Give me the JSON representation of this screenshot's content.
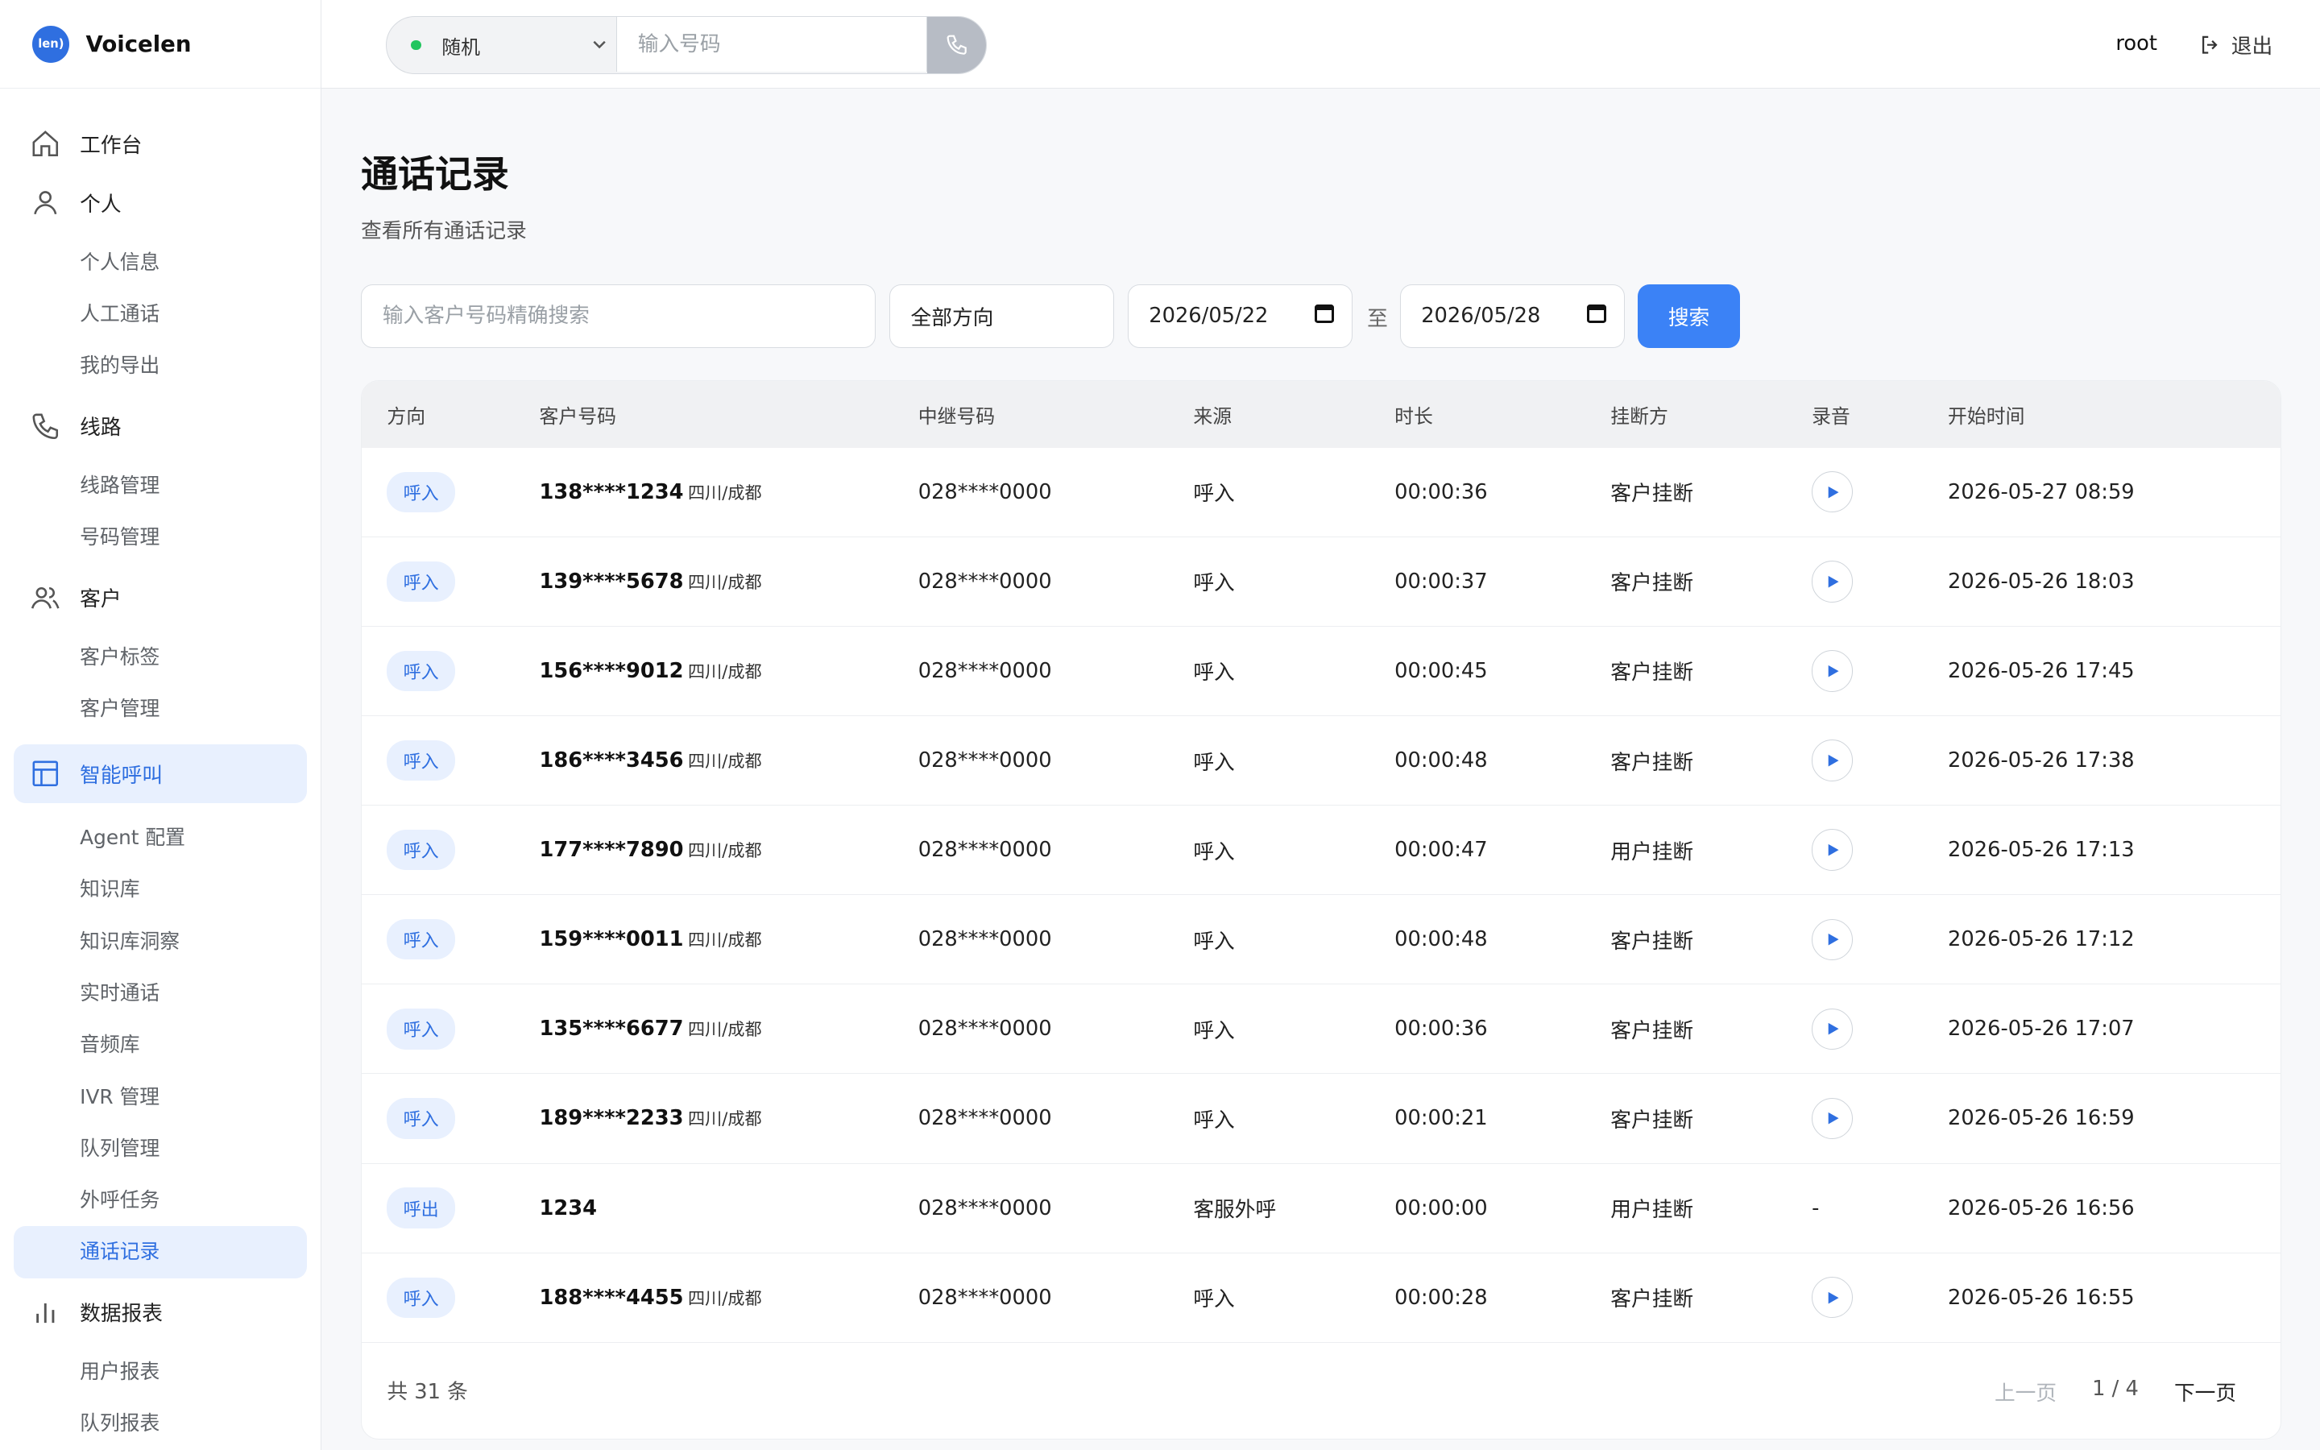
{
  "app": {
    "name": "Voicelen",
    "logo_text": "len)"
  },
  "sidebar": {
    "workbench": "工作台",
    "personal": "个人",
    "personal_items": [
      "个人信息",
      "人工通话",
      "我的导出"
    ],
    "lines": "线路",
    "lines_items": [
      "线路管理",
      "号码管理"
    ],
    "customer": "客户",
    "customer_items": [
      "客户标签",
      "客户管理"
    ],
    "smart_call": "智能呼叫",
    "smart_items": [
      "Agent 配置",
      "知识库",
      "知识库洞察",
      "实时通话",
      "音频库",
      "IVR 管理",
      "队列管理",
      "外呼任务",
      "通话记录"
    ],
    "reports": "数据报表",
    "reports_items": [
      "用户报表",
      "队列报表"
    ]
  },
  "topbar": {
    "mode": "随机",
    "phone_placeholder": "输入号码",
    "user": "root",
    "logout": "退出"
  },
  "page": {
    "title": "通话记录",
    "subtitle": "查看所有通话记录"
  },
  "filters": {
    "search_placeholder": "输入客户号码精确搜索",
    "direction": "全部方向",
    "date_from": "2026/05/22",
    "to": "至",
    "date_to": "2026/05/28",
    "search": "搜索"
  },
  "table": {
    "headers": [
      "方向",
      "客户号码",
      "中继号码",
      "来源",
      "时长",
      "挂断方",
      "录音",
      "开始时间"
    ],
    "rows": [
      {
        "dir": "呼入",
        "num": "138****1234",
        "loc": "四川/成都",
        "trunk": "028****0000",
        "src": "呼入",
        "dur": "00:00:36",
        "hang": "客户挂断",
        "rec": true,
        "time": "2026-05-27 08:59"
      },
      {
        "dir": "呼入",
        "num": "139****5678",
        "loc": "四川/成都",
        "trunk": "028****0000",
        "src": "呼入",
        "dur": "00:00:37",
        "hang": "客户挂断",
        "rec": true,
        "time": "2026-05-26 18:03"
      },
      {
        "dir": "呼入",
        "num": "156****9012",
        "loc": "四川/成都",
        "trunk": "028****0000",
        "src": "呼入",
        "dur": "00:00:45",
        "hang": "客户挂断",
        "rec": true,
        "time": "2026-05-26 17:45"
      },
      {
        "dir": "呼入",
        "num": "186****3456",
        "loc": "四川/成都",
        "trunk": "028****0000",
        "src": "呼入",
        "dur": "00:00:48",
        "hang": "客户挂断",
        "rec": true,
        "time": "2026-05-26 17:38"
      },
      {
        "dir": "呼入",
        "num": "177****7890",
        "loc": "四川/成都",
        "trunk": "028****0000",
        "src": "呼入",
        "dur": "00:00:47",
        "hang": "用户挂断",
        "rec": true,
        "time": "2026-05-26 17:13"
      },
      {
        "dir": "呼入",
        "num": "159****0011",
        "loc": "四川/成都",
        "trunk": "028****0000",
        "src": "呼入",
        "dur": "00:00:48",
        "hang": "客户挂断",
        "rec": true,
        "time": "2026-05-26 17:12"
      },
      {
        "dir": "呼入",
        "num": "135****6677",
        "loc": "四川/成都",
        "trunk": "028****0000",
        "src": "呼入",
        "dur": "00:00:36",
        "hang": "客户挂断",
        "rec": true,
        "time": "2026-05-26 17:07"
      },
      {
        "dir": "呼入",
        "num": "189****2233",
        "loc": "四川/成都",
        "trunk": "028****0000",
        "src": "呼入",
        "dur": "00:00:21",
        "hang": "客户挂断",
        "rec": true,
        "time": "2026-05-26 16:59"
      },
      {
        "dir": "呼出",
        "num": "1234",
        "loc": "",
        "trunk": "028****0000",
        "src": "客服外呼",
        "dur": "00:00:00",
        "hang": "用户挂断",
        "rec": false,
        "rec_text": "-",
        "time": "2026-05-26 16:56"
      },
      {
        "dir": "呼入",
        "num": "188****4455",
        "loc": "四川/成都",
        "trunk": "028****0000",
        "src": "呼入",
        "dur": "00:00:28",
        "hang": "客户挂断",
        "rec": true,
        "time": "2026-05-26 16:55"
      }
    ],
    "total": "共 31 条",
    "prev": "上一页",
    "page": "1 / 4",
    "next": "下一页"
  },
  "colors": {
    "accent": "#3b82f6",
    "active_bg": "#e8f0fe"
  }
}
